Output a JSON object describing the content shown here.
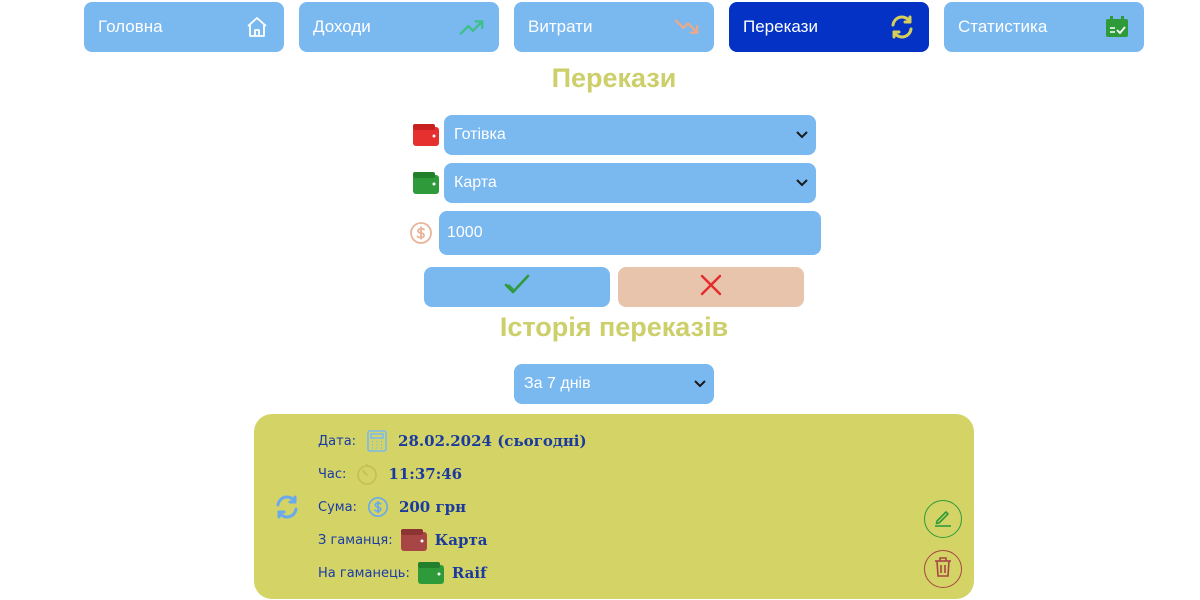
{
  "nav": {
    "items": [
      {
        "label": "Головна",
        "icon": "home-icon"
      },
      {
        "label": "Доходи",
        "icon": "trending-up-icon"
      },
      {
        "label": "Витрати",
        "icon": "trending-down-icon"
      },
      {
        "label": "Перекази",
        "icon": "refresh-icon",
        "active": true
      },
      {
        "label": "Статистика",
        "icon": "calendar-check-icon"
      }
    ]
  },
  "form": {
    "title": "Перекази",
    "from_wallet": "Готівка",
    "to_wallet": "Карта",
    "amount": "1000",
    "confirm_icon": "checkmark-icon",
    "cancel_icon": "close-icon"
  },
  "history": {
    "title": "Історія переказів",
    "period": "За 7 днів",
    "entries": [
      {
        "date_label": "Дата:",
        "date": "28.02.2024 (сьогодні)",
        "time_label": "Час:",
        "time": "11:37:46",
        "sum_label": "Сума:",
        "sum": "200 грн",
        "from_label": "З гаманця:",
        "from": "Карта",
        "to_label": "На гаманець:",
        "to": "Raif"
      }
    ]
  },
  "colors": {
    "nav_bg": "#7ab8f0",
    "nav_active": "#0332c4",
    "title": "#cccf6a",
    "card_bg": "#d3d465",
    "cancel_bg": "#e8c4ad"
  }
}
